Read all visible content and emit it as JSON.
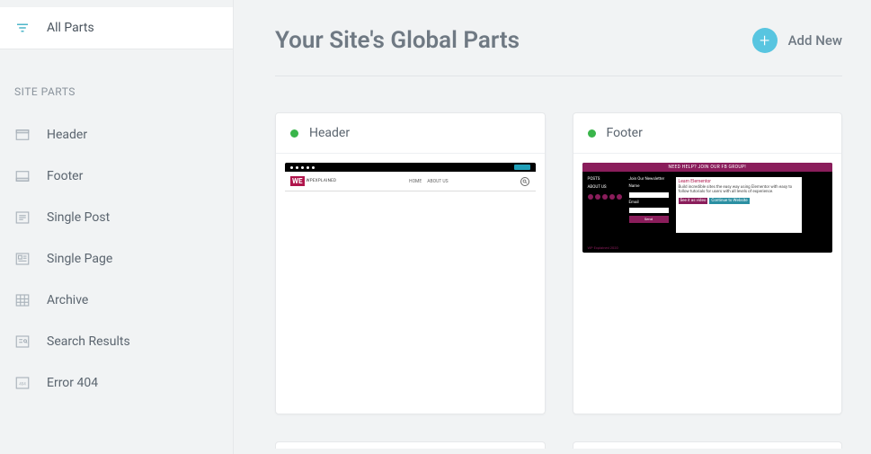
{
  "sidebar": {
    "all_parts_label": "All Parts",
    "section_label": "SITE PARTS",
    "items": [
      {
        "label": "Header",
        "icon": "header-icon"
      },
      {
        "label": "Footer",
        "icon": "footer-icon"
      },
      {
        "label": "Single Post",
        "icon": "single-post-icon"
      },
      {
        "label": "Single Page",
        "icon": "single-page-icon"
      },
      {
        "label": "Archive",
        "icon": "archive-icon"
      },
      {
        "label": "Search Results",
        "icon": "search-results-icon"
      },
      {
        "label": "Error 404",
        "icon": "error-404-icon"
      }
    ]
  },
  "main": {
    "title": "Your Site's Global Parts",
    "add_new_label": "Add New",
    "cards": [
      {
        "title": "Header",
        "status": "active"
      },
      {
        "title": "Footer",
        "status": "active"
      }
    ]
  },
  "previews": {
    "header": {
      "logo_mark": "WE",
      "logo_sub": "WPEXPLAINED",
      "nav1": "HOME",
      "nav2": "ABOUT US"
    },
    "footer": {
      "banner": "NEED HELP? JOIN OUR FB GROUP!",
      "posts_label": "POSTS",
      "about_label": "ABOUT US",
      "newsletter_label": "Join Our Newsletter",
      "name_label": "Name",
      "email_label": "Email",
      "send_label": "Send",
      "learn_title": "Learn Elementor",
      "learn_desc": "Build incredible sites the easy way using Elementor with easy to follow tutorials for users with all levels of experience.",
      "btn1": "See it as video",
      "btn2": "Continue to Website",
      "copyright": "WP Explained 2020"
    }
  }
}
